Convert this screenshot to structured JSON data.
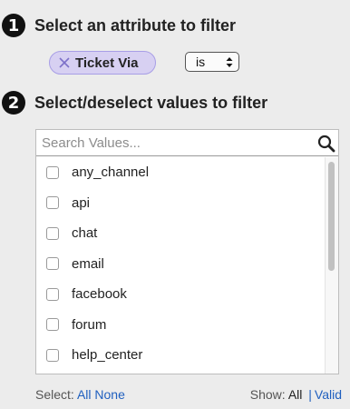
{
  "steps": [
    {
      "number": "1",
      "title": "Select an attribute to filter"
    },
    {
      "number": "2",
      "title": "Select/deselect values to filter"
    }
  ],
  "attribute_chip": {
    "label": "Ticket Via",
    "remove_icon": "close-icon"
  },
  "operator": {
    "selected": "is",
    "icon": "select-arrows-icon"
  },
  "search": {
    "placeholder": "Search Values...",
    "value": "",
    "icon": "search-icon"
  },
  "values": [
    {
      "label": "any_channel",
      "checked": false
    },
    {
      "label": "api",
      "checked": false
    },
    {
      "label": "chat",
      "checked": false
    },
    {
      "label": "email",
      "checked": false
    },
    {
      "label": "facebook",
      "checked": false
    },
    {
      "label": "forum",
      "checked": false
    },
    {
      "label": "help_center",
      "checked": false
    }
  ],
  "footer": {
    "select_label": "Select:",
    "select_all": "All",
    "select_none": "None",
    "show_label": "Show:",
    "show_all": "All",
    "separator": "|",
    "show_valid": "Valid"
  },
  "colors": {
    "chip_bg": "#d7d0f2",
    "link": "#1f5fbf",
    "background": "#ececec"
  }
}
